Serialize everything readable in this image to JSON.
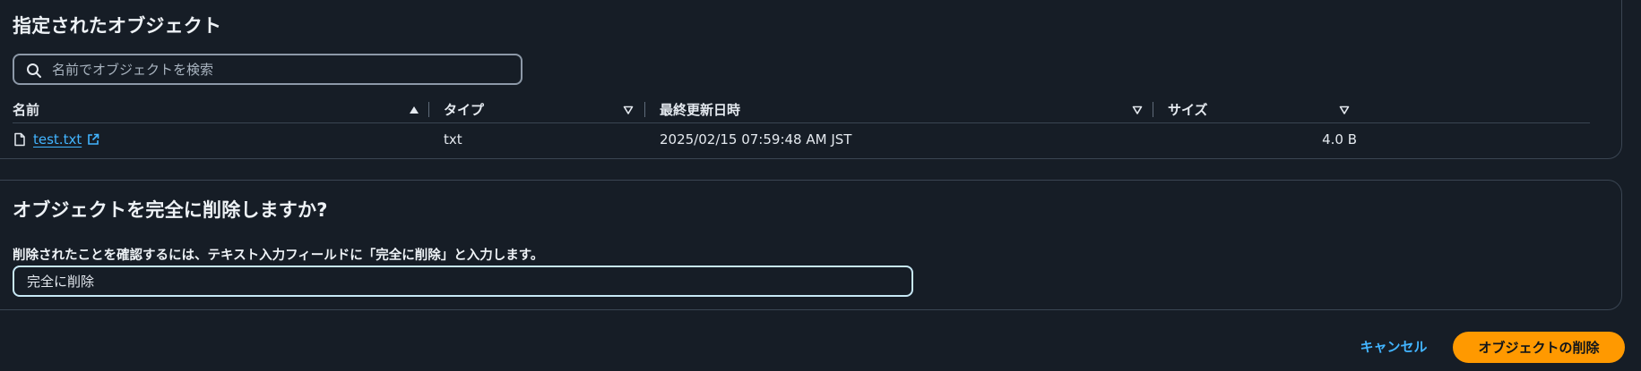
{
  "objects_panel": {
    "title": "指定されたオブジェクト",
    "search": {
      "placeholder": "名前でオブジェクトを検索",
      "value": "",
      "icon": "search-icon"
    },
    "table": {
      "columns": [
        {
          "label": "名前",
          "sort": "ascending"
        },
        {
          "label": "タイプ",
          "sort": "none"
        },
        {
          "label": "最終更新日時",
          "sort": "none"
        },
        {
          "label": "サイズ",
          "sort": "none"
        }
      ],
      "rows": [
        {
          "name": "test.txt",
          "type": "txt",
          "last_modified": "2025/02/15 07:59:48 AM JST",
          "size": "4.0 B"
        }
      ]
    }
  },
  "confirm_panel": {
    "title": "オブジェクトを完全に削除しますか?",
    "instruction": "削除されたことを確認するには、テキスト入力フィールドに「完全に削除」と入力します。",
    "input_value": "完全に削除"
  },
  "footer": {
    "cancel_label": "キャンセル",
    "delete_label": "オブジェクトの削除"
  },
  "colors": {
    "background": "#161d26",
    "link": "#42b4ff",
    "primary_button": "#ff9900",
    "border": "#3a4552"
  }
}
